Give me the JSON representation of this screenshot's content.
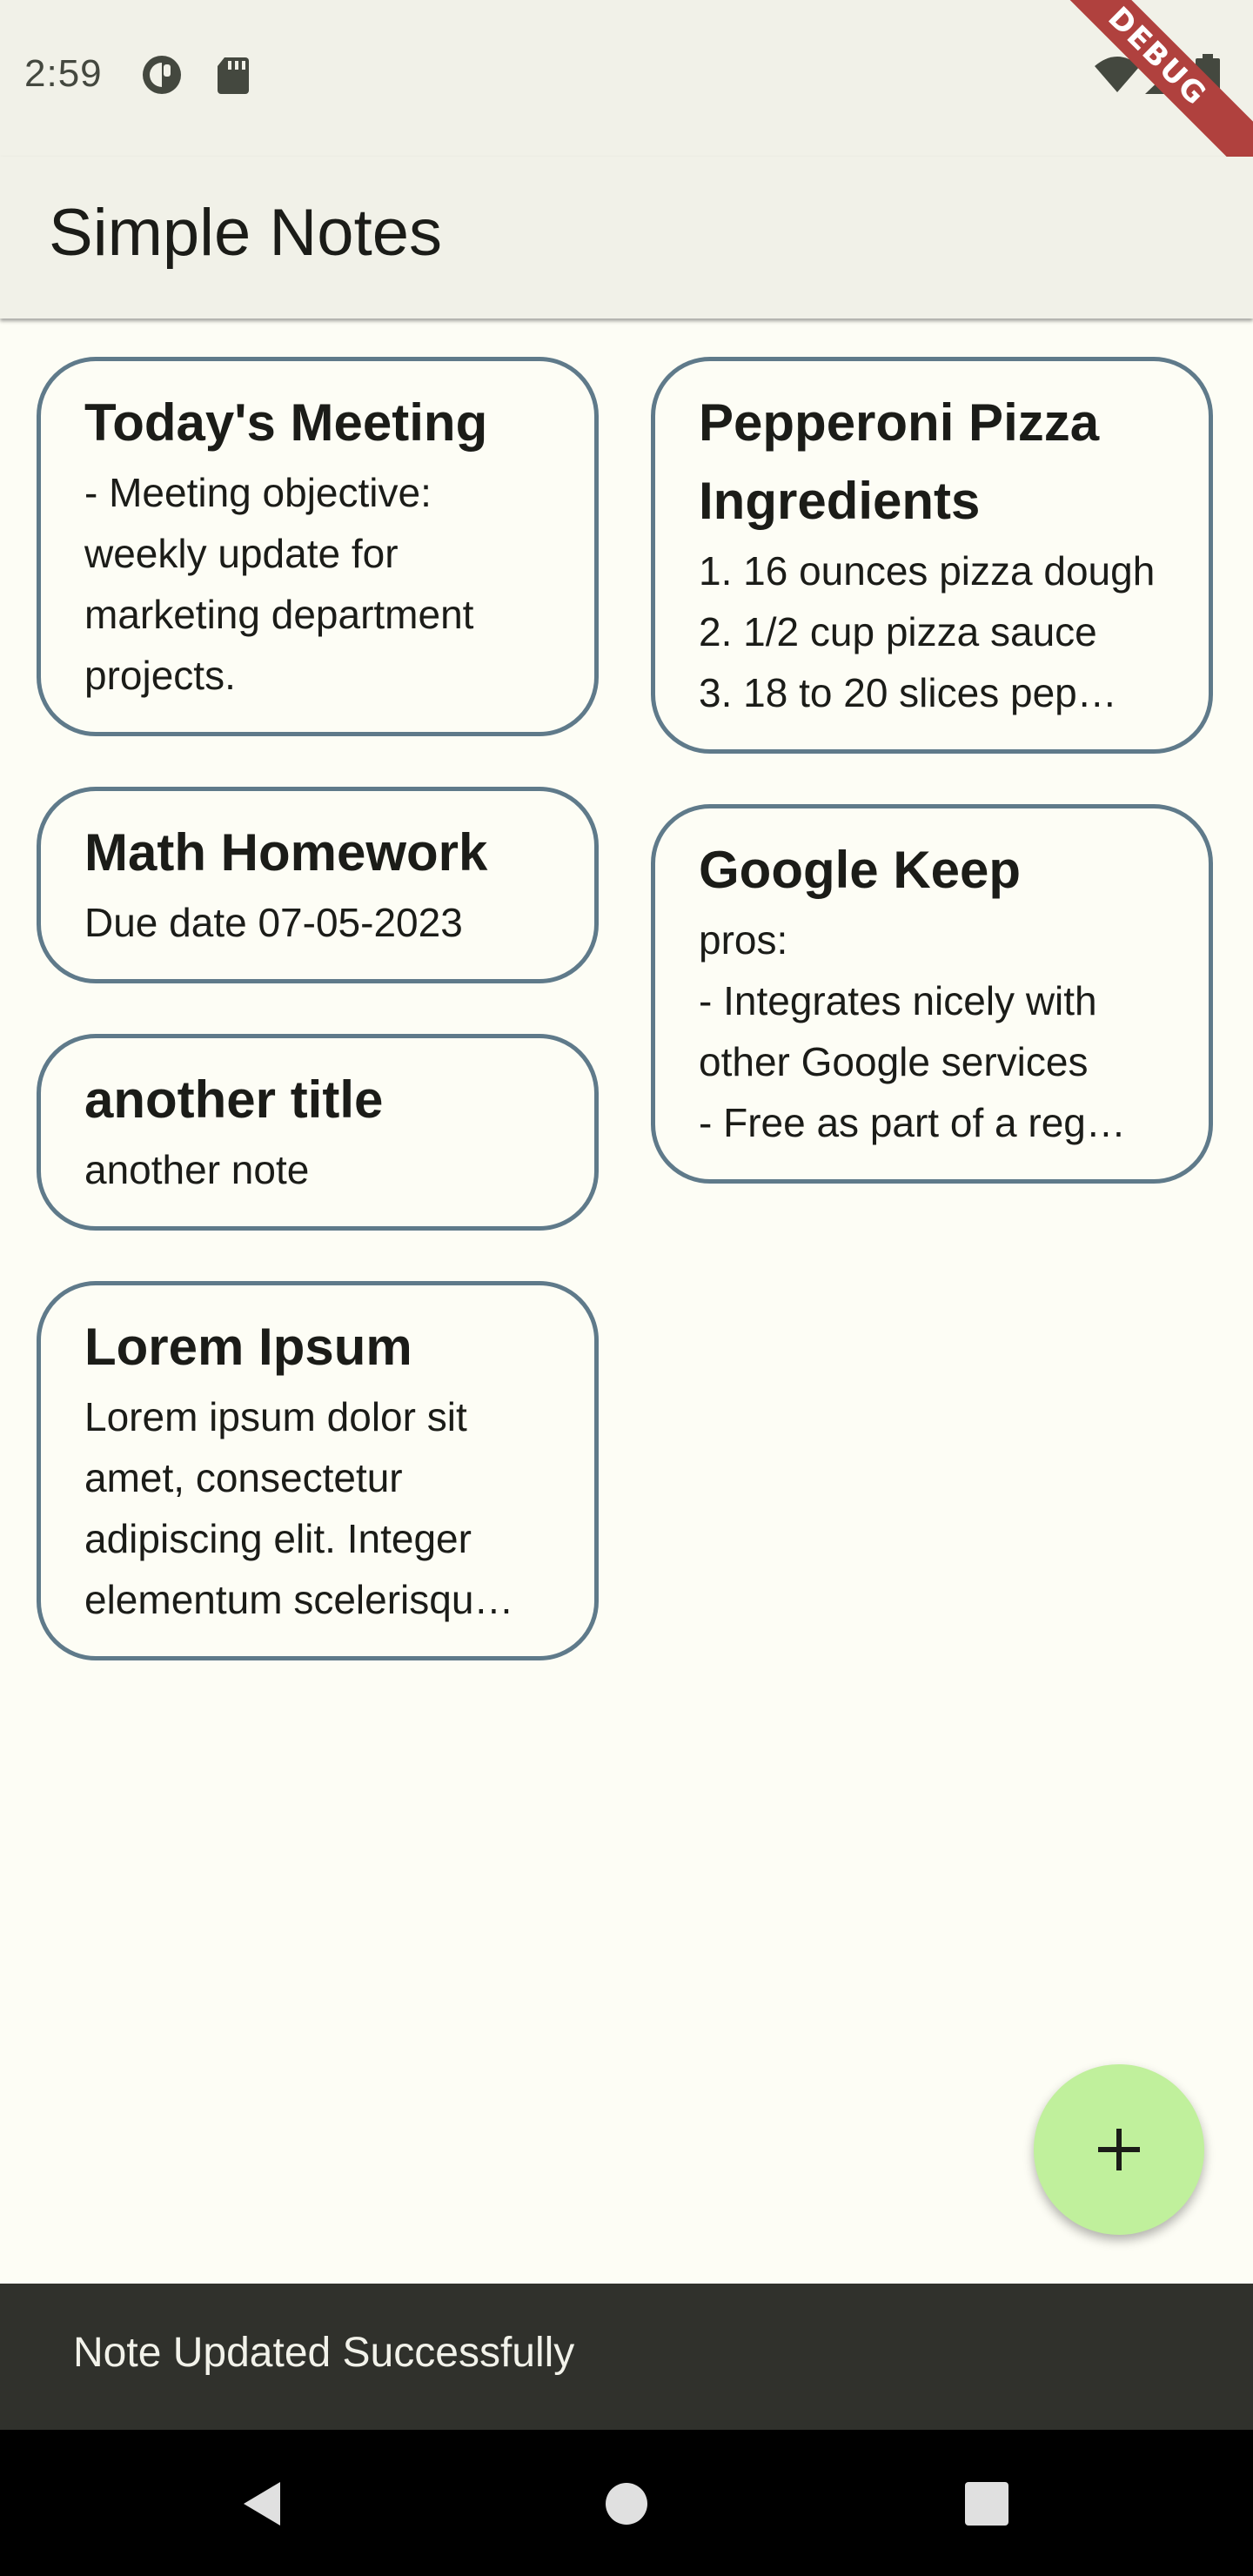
{
  "status_bar": {
    "time": "2:59",
    "icons": [
      "notification-app-icon",
      "sd-card-icon",
      "wifi-icon",
      "signal-icon",
      "battery-icon"
    ],
    "debug_label": "DEBUG"
  },
  "app_bar": {
    "title": "Simple Notes"
  },
  "notes": {
    "left": [
      {
        "title": "Today's Meeting",
        "body": "- Meeting objective: weekly update for marketing department projects."
      },
      {
        "title": "Math Homework",
        "body": "Due date 07-05-2023"
      },
      {
        "title": "another title",
        "body": "another note"
      },
      {
        "title": "Lorem Ipsum",
        "body": "Lorem ipsum dolor sit amet, consectetur adipiscing elit. Integer elementum scelerisqu…"
      }
    ],
    "right": [
      {
        "title": "Pepperoni Pizza Ingredients",
        "body": "1. 16 ounces pizza dough\n2. 1/2 cup pizza sauce\n3. 18 to 20 slices pep…"
      },
      {
        "title": "Google Keep",
        "body": "pros:\n- Integrates nicely with other Google services\n- Free as part of a reg…"
      }
    ]
  },
  "fab": {
    "icon": "plus-icon"
  },
  "snackbar": {
    "message": "Note Updated Successfully"
  },
  "nav_bar": {
    "icons": [
      "back-icon",
      "home-icon",
      "recents-icon"
    ]
  },
  "colors": {
    "background": "#fdfdf5",
    "app_bar": "#f1f1e8",
    "card_border": "#5f7a8a",
    "fab": "#c0f09c",
    "snackbar": "#30312c",
    "debug_banner": "#b0413e"
  }
}
